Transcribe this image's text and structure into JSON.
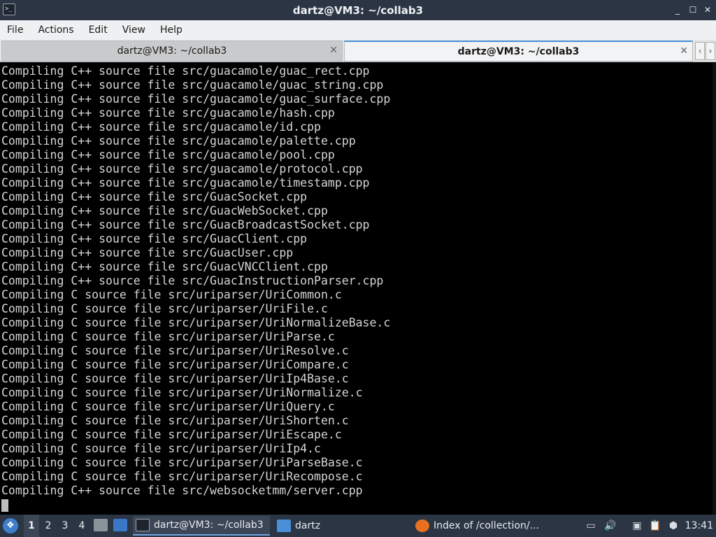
{
  "window": {
    "title": "dartz@VM3: ~/collab3",
    "controls": {
      "minimize": "_",
      "maximize": "☐",
      "close": "✕"
    }
  },
  "menubar": {
    "items": [
      "File",
      "Actions",
      "Edit",
      "View",
      "Help"
    ]
  },
  "tabs": [
    {
      "label": "dartz@VM3: ~/collab3",
      "active": false
    },
    {
      "label": "dartz@VM3: ~/collab3",
      "active": true
    }
  ],
  "tab_close_glyph": "✕",
  "terminal": {
    "lines": [
      "Compiling C++ source file src/guacamole/guac_rect.cpp",
      "Compiling C++ source file src/guacamole/guac_string.cpp",
      "Compiling C++ source file src/guacamole/guac_surface.cpp",
      "Compiling C++ source file src/guacamole/hash.cpp",
      "Compiling C++ source file src/guacamole/id.cpp",
      "Compiling C++ source file src/guacamole/palette.cpp",
      "Compiling C++ source file src/guacamole/pool.cpp",
      "Compiling C++ source file src/guacamole/protocol.cpp",
      "Compiling C++ source file src/guacamole/timestamp.cpp",
      "Compiling C++ source file src/GuacSocket.cpp",
      "Compiling C++ source file src/GuacWebSocket.cpp",
      "Compiling C++ source file src/GuacBroadcastSocket.cpp",
      "Compiling C++ source file src/GuacClient.cpp",
      "Compiling C++ source file src/GuacUser.cpp",
      "Compiling C++ source file src/GuacVNCClient.cpp",
      "Compiling C++ source file src/GuacInstructionParser.cpp",
      "Compiling C source file src/uriparser/UriCommon.c",
      "Compiling C source file src/uriparser/UriFile.c",
      "Compiling C source file src/uriparser/UriNormalizeBase.c",
      "Compiling C source file src/uriparser/UriParse.c",
      "Compiling C source file src/uriparser/UriResolve.c",
      "Compiling C source file src/uriparser/UriCompare.c",
      "Compiling C source file src/uriparser/UriIp4Base.c",
      "Compiling C source file src/uriparser/UriNormalize.c",
      "Compiling C source file src/uriparser/UriQuery.c",
      "Compiling C source file src/uriparser/UriShorten.c",
      "Compiling C source file src/uriparser/UriEscape.c",
      "Compiling C source file src/uriparser/UriIp4.c",
      "Compiling C source file src/uriparser/UriParseBase.c",
      "Compiling C source file src/uriparser/UriRecompose.c",
      "Compiling C++ source file src/websocketmm/server.cpp"
    ]
  },
  "taskbar": {
    "workspaces": [
      "1",
      "2",
      "3",
      "4"
    ],
    "current_workspace": "1",
    "tasks": [
      {
        "label": "dartz@VM3: ~/collab3",
        "icon": "terminal-icon"
      },
      {
        "label": "dartz",
        "icon": "folder-icon"
      },
      {
        "label": "Index of /collection/...",
        "icon": "firefox-icon"
      }
    ],
    "clock": "13:41"
  },
  "colors": {
    "titlebar_bg": "#2b3544",
    "terminal_bg": "#000000",
    "terminal_fg": "#d6d6d6",
    "accent": "#4a90d9"
  }
}
